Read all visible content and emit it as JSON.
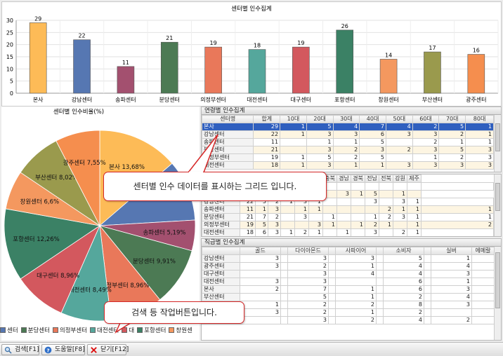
{
  "bar_chart": {
    "title": "센터별 인수집계",
    "chart_data": {
      "type": "bar",
      "categories": [
        "본사",
        "강남센터",
        "송파센터",
        "분당센터",
        "의정부센터",
        "대전센터",
        "대구센터",
        "포항센터",
        "창원센터",
        "부산센터",
        "광주센터"
      ],
      "values": [
        29,
        22,
        11,
        21,
        19,
        18,
        19,
        26,
        14,
        17,
        16
      ],
      "colors": [
        "#fdbb57",
        "#5677b2",
        "#a3506f",
        "#4c7a54",
        "#e9785a",
        "#55a79c",
        "#d3585e",
        "#3b8165",
        "#f4985f",
        "#9a9a4d",
        "#f58e4e"
      ],
      "ylim": [
        0,
        30
      ],
      "yticks": [
        "0",
        "5",
        "10",
        "15",
        "20",
        "25",
        "30"
      ],
      "grid": true
    }
  },
  "pie_chart": {
    "title": "센터별 인수비율(%)",
    "chart_data": {
      "type": "pie",
      "labels": [
        "본사 13,68%",
        "강남센터",
        "송파센터 5,19%",
        "분당센터 9,91%",
        "의정부센터 8,96%",
        "대전센터 8,49%",
        "대구센터 8,96%",
        "포항센터 12,26%",
        "창원센터 6,6%",
        "부산센터 8,02%",
        "광주센터 7,55%"
      ],
      "values": [
        13.68,
        10.38,
        5.19,
        9.91,
        8.96,
        8.49,
        8.96,
        12.26,
        6.6,
        8.02,
        7.55
      ],
      "colors": [
        "#fdbb57",
        "#5677b2",
        "#a3506f",
        "#4c7a54",
        "#e9785a",
        "#55a79c",
        "#d3585e",
        "#3b8165",
        "#f4985f",
        "#9a9a4d",
        "#f58e4e"
      ],
      "label_visible": [
        true,
        false,
        true,
        true,
        true,
        true,
        true,
        true,
        true,
        true,
        true
      ]
    }
  },
  "legend": [
    {
      "label": "센터",
      "color": "#5677b2"
    },
    {
      "label": "분당센터",
      "color": "#4c7a54"
    },
    {
      "label": "의정부센터",
      "color": "#e9785a"
    },
    {
      "label": "대전센터",
      "color": "#55a79c"
    },
    {
      "label": "대",
      "color": "#d3585e"
    },
    {
      "label": "포항센터",
      "color": "#3b8165"
    },
    {
      "label": "창원센",
      "color": "#f4985f"
    }
  ],
  "grid1": {
    "title": "연령별 인수집계",
    "headers": [
      "센터명",
      "합계",
      "10대",
      "20대",
      "30대",
      "40대",
      "50대",
      "60대",
      "70대",
      "80대"
    ],
    "rows": [
      [
        "본사",
        "29",
        "1",
        "5",
        "4",
        "7",
        "4",
        "2",
        "5",
        "1"
      ],
      [
        "강남센터",
        "22",
        "1",
        "3",
        "3",
        "6",
        "3",
        "3",
        "2",
        "1"
      ],
      [
        "송파센터",
        "11",
        "",
        "1",
        "1",
        "5",
        "",
        "2",
        "1",
        "1"
      ],
      [
        "분당센터",
        "21",
        "",
        "3",
        "2",
        "3",
        "2",
        "3",
        "5",
        "3"
      ],
      [
        "의정부센터",
        "19",
        "1",
        "5",
        "2",
        "5",
        "",
        "1",
        "2",
        "3"
      ],
      [
        "대전센터",
        "18",
        "1",
        "3",
        "1",
        "1",
        "3",
        "3",
        "3",
        "3"
      ]
    ]
  },
  "grid2": {
    "headers_visible": [
      "대구",
      "울산",
      "인천",
      "충남",
      "충북",
      "경남",
      "경북",
      "전남",
      "전북",
      "강원",
      "제주"
    ],
    "rows": [
      [
        "",
        "",
        "3",
        "5",
        "",
        "",
        "",
        "",
        "",
        "",
        "",
        "",
        "",
        "",
        ""
      ],
      [
        "",
        "",
        "",
        "",
        "",
        "",
        "2",
        "",
        "3",
        "1",
        "5",
        "",
        "1",
        ""
      ],
      [
        "강남센터",
        "22",
        "5",
        "2",
        "1",
        "3",
        "1",
        "",
        "",
        "",
        "3",
        "",
        "3",
        "1",
        ""
      ],
      [
        "송파센터",
        "11",
        "1",
        "3",
        "",
        "1",
        "1",
        "",
        "",
        "",
        "",
        "2",
        "1",
        "1",
        "1"
      ],
      [
        "분당센터",
        "21",
        "7",
        "2",
        "",
        "3",
        "",
        "1",
        "",
        "",
        "1",
        "2",
        "3",
        "1",
        "1"
      ],
      [
        "의정부센터",
        "19",
        "5",
        "3",
        "",
        "",
        "3",
        "1",
        "",
        "1",
        "2",
        "1",
        "",
        "1",
        "2"
      ],
      [
        "대전센터",
        "18",
        "6",
        "3",
        "1",
        "2",
        "1",
        "",
        "1",
        "",
        "3",
        "",
        "2",
        "1",
        ""
      ]
    ]
  },
  "grid3": {
    "title": "직급별 인수집계",
    "headers": [
      "",
      "골드",
      "",
      "다이아몬드",
      "",
      "사파이어",
      "",
      "소비자",
      "",
      "실버",
      "에메랄"
    ],
    "rows": [
      [
        "강남센터",
        "3",
        "",
        "3",
        "",
        "3",
        "",
        "5",
        "",
        "1",
        ""
      ],
      [
        "광주센터",
        "3",
        "",
        "2",
        "",
        "1",
        "",
        "4",
        "",
        "4",
        ""
      ],
      [
        "대구센터",
        "",
        "",
        "3",
        "",
        "4",
        "",
        "4",
        "",
        "3",
        ""
      ],
      [
        "대전센터",
        "3",
        "",
        "3",
        "",
        "",
        "",
        "6",
        "",
        "1",
        ""
      ],
      [
        "본사",
        "2",
        "",
        "7",
        "",
        "1",
        "",
        "6",
        "",
        "3",
        ""
      ],
      [
        "부산센터",
        "",
        "",
        "5",
        "",
        "1",
        "",
        "2",
        "",
        "4",
        ""
      ],
      [
        "분당센터",
        "1",
        "",
        "2",
        "",
        "2",
        "",
        "8",
        "",
        "3",
        ""
      ],
      [
        "송파센터",
        "3",
        "",
        "2",
        "",
        "1",
        "",
        "2",
        "",
        "",
        ""
      ],
      [
        "의정부센터",
        "",
        "",
        "3",
        "",
        "2",
        "",
        "4",
        "",
        "2",
        ""
      ]
    ]
  },
  "callouts": {
    "grid_note": "센터별 인수 데이터를 표시하는 그리드 입니다.",
    "toolbar_note": "검색 등 작업버튼입니다."
  },
  "toolbar": {
    "search_label": "검색[F1]",
    "help_label": "도움말[F8]",
    "close_label": "닫기[F12]"
  }
}
